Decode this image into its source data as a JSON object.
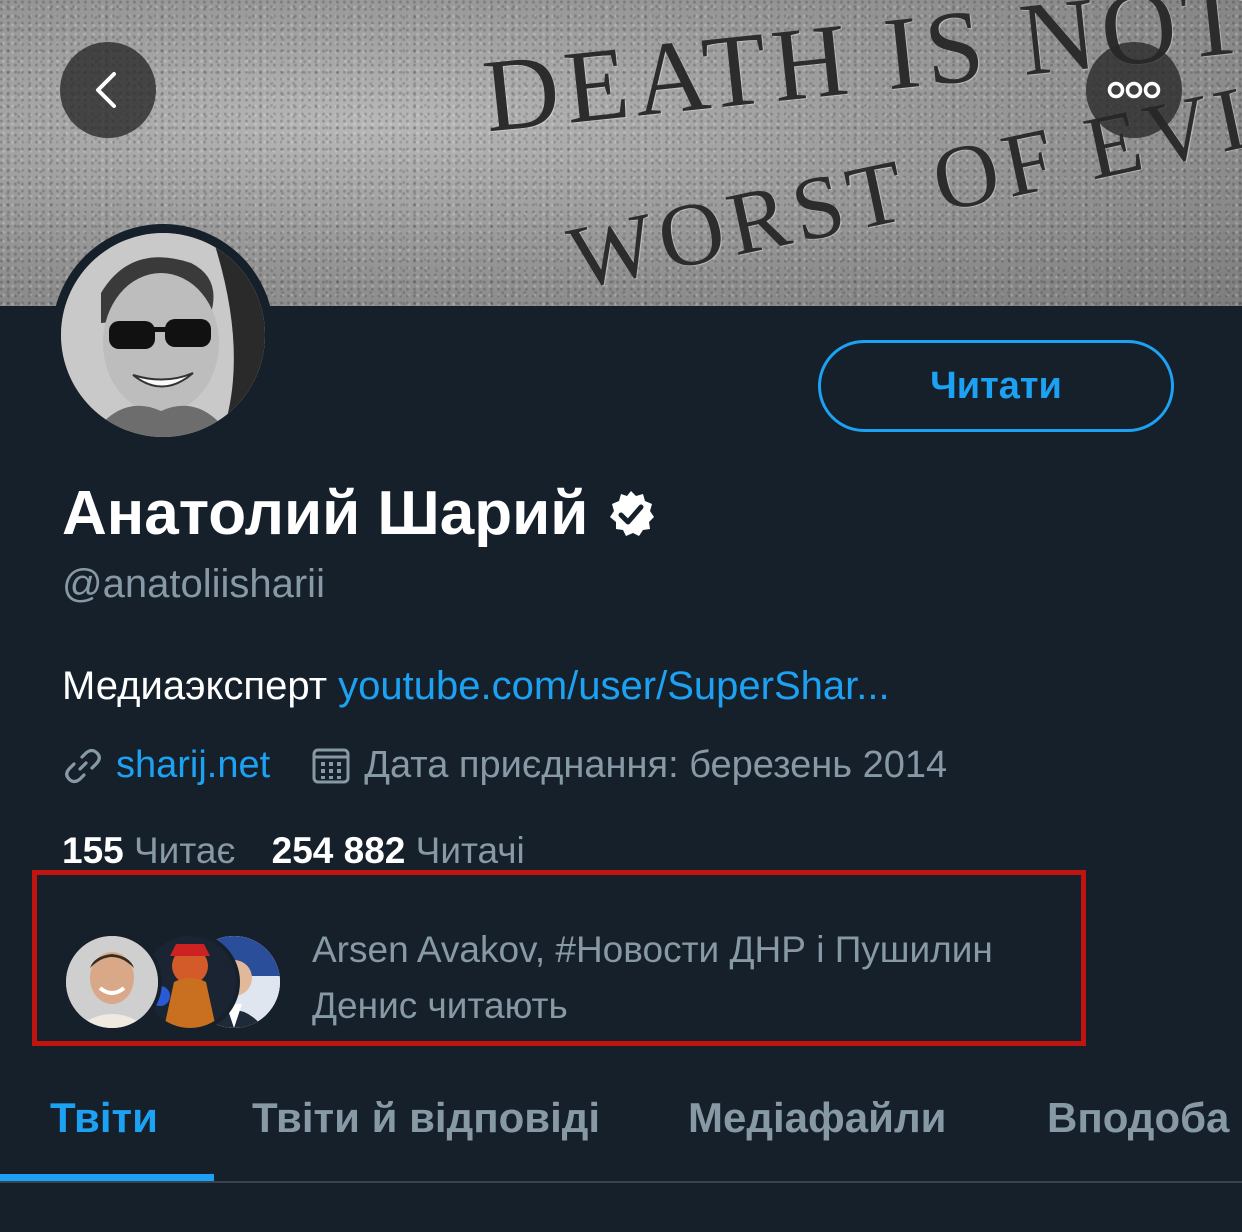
{
  "banner": {
    "line1": "DEATH IS NOT",
    "line2": "WORST OF EVILS"
  },
  "profile": {
    "name": "Анатолий Шарий",
    "handle": "@anatoliisharii",
    "follow_label": "Читати",
    "bio_text": "Медиаэксперт",
    "bio_link": "youtube.com/user/SuperShar...",
    "website": "sharij.net",
    "joined": "Дата приєднання: березень 2014"
  },
  "stats": {
    "following_count": "155",
    "following_label": "Читає",
    "followers_count": "254 882",
    "followers_label": "Читачі"
  },
  "followed_by": {
    "line1": "Arsen Avakov, #Новости ДНР і Пушилин",
    "line2": "Денис читають"
  },
  "tabs": [
    {
      "label": "Твіти"
    },
    {
      "label": "Твіти й відповіді"
    },
    {
      "label": "Медіафайли"
    },
    {
      "label": "Вподоба"
    }
  ],
  "colors": {
    "accent": "#1da1f2",
    "background": "#15202b",
    "muted": "#8899a6",
    "highlight_box": "#c0150f"
  }
}
